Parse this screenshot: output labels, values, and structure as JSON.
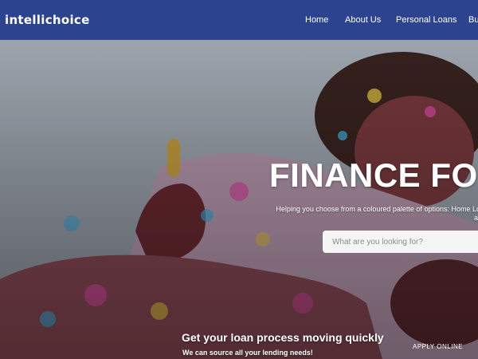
{
  "brand": {
    "logo_text": "intellichoice"
  },
  "nav": {
    "items": [
      {
        "label": "Home"
      },
      {
        "label": "About Us"
      },
      {
        "label": "Personal Loans"
      },
      {
        "label": "Bus"
      }
    ]
  },
  "hero": {
    "title": "FINANCE FO",
    "subtitle_line1": "Helping you choose from a coloured palette of options: Home Loans,",
    "subtitle_line2": "and m",
    "search_placeholder": "What are you looking for?",
    "cta_title": "Get your loan process moving quickly",
    "cta_subtitle": "We can source all your lending needs!",
    "apply_label": "APPLY ONLINE"
  },
  "colors": {
    "nav_background": "#2c4490",
    "text": "#ffffff"
  }
}
